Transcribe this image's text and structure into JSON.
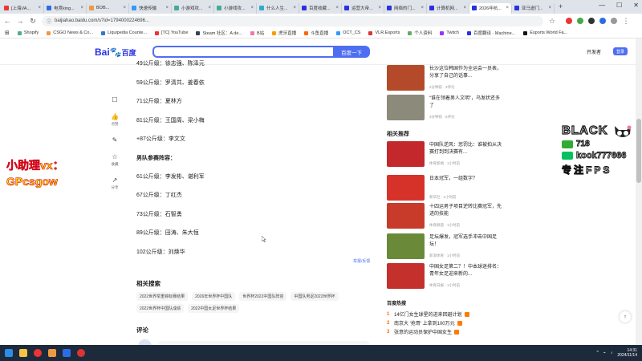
{
  "tabs": [
    {
      "label": "[上海VA...",
      "fav": "#e33"
    },
    {
      "label": "电竞king...",
      "fav": "#2b6de5"
    },
    {
      "label": "BOB...",
      "fav": "#e94"
    },
    {
      "label": "快速传输",
      "fav": "#39f"
    },
    {
      "label": "小游戏攻...",
      "fav": "#4a9"
    },
    {
      "label": "小游戏攻...",
      "fav": "#4a9"
    },
    {
      "label": "什么人生...",
      "fav": "#3ac"
    },
    {
      "label": "百度收藏...",
      "fav": "#2932e1"
    },
    {
      "label": "运营大帝...",
      "fav": "#2932e1"
    },
    {
      "label": "网络的门...",
      "fav": "#2932e1"
    },
    {
      "label": "计算机网...",
      "fav": "#2932e1"
    },
    {
      "label": "2026年杭...",
      "fav": "#2932e1",
      "active": true
    },
    {
      "label": "亚马逊门...",
      "fav": "#2932e1"
    }
  ],
  "address": "baijiahao.baidu.com/s?id=1794000224696...",
  "bookmarks": [
    {
      "label": "Shopify",
      "color": "#5a8"
    },
    {
      "label": "CSGO News & Co...",
      "color": "#e94"
    },
    {
      "label": "Liquipedia Counte...",
      "color": "#37c"
    },
    {
      "label": "[TC] YouTube",
      "color": "#e33"
    },
    {
      "label": "Steam 社区：A de...",
      "color": "#345"
    },
    {
      "label": "B站",
      "color": "#e7a"
    },
    {
      "label": "虎牙直播",
      "color": "#f90"
    },
    {
      "label": "斗鱼直播",
      "color": "#f60"
    },
    {
      "label": "OCT_CS",
      "color": "#39f"
    },
    {
      "label": "VLR.Esports",
      "color": "#d33"
    },
    {
      "label": "个人资料",
      "color": "#6a6"
    },
    {
      "label": "Twitch",
      "color": "#93f"
    },
    {
      "label": "百度翻译 · Machine...",
      "color": "#2932e1"
    },
    {
      "label": "Esports World Fa...",
      "color": "#111"
    }
  ],
  "header": {
    "logo_text": "Bai",
    "logo_du": "度",
    "logo_suffix": "百度",
    "search_button": "百度一下",
    "link": "开发者",
    "login": "登录"
  },
  "side_actions": [
    {
      "icon": "☐",
      "count": ""
    },
    {
      "icon": "👍",
      "count": "点赞"
    },
    {
      "icon": "✎",
      "count": ""
    },
    {
      "icon": "☆",
      "count": "收藏"
    },
    {
      "icon": "↗",
      "count": "分享"
    }
  ],
  "article_lines": [
    {
      "text": "49公斤级：徐志强、陈泽元",
      "section": false
    },
    {
      "text": "59公斤级：罗清共、姜春依",
      "section": false
    },
    {
      "text": "71公斤级：夏林方",
      "section": false
    },
    {
      "text": "81公斤级：王国周、梁小梅",
      "section": false
    },
    {
      "text": "+87公斤级：李文文",
      "section": false
    },
    {
      "text": "男队参赛阵容：",
      "section": true
    },
    {
      "text": "61公斤级：李发彬、谌利军",
      "section": false
    },
    {
      "text": "67公斤级：丁红杰",
      "section": false
    },
    {
      "text": "73公斤级：石智勇",
      "section": false
    },
    {
      "text": "89公斤级：田涛、朱大恒",
      "section": false
    },
    {
      "text": "102公斤级：刘焕华",
      "section": false
    }
  ],
  "report_link": "举报/反馈",
  "related": {
    "title": "相关搜索",
    "tags": [
      "2022世界举重锦标赛结果",
      "2026年世界杯中国队",
      "世界杯2022中国队阵容",
      "中国队男足2022世界杯",
      "2022世界杯中国队成绩",
      "2022中国女足世界杯结果"
    ]
  },
  "comments_title": "评论",
  "right_items_top": [
    {
      "title": "长沙这位韩国作为全运会一员表，分享了自己的话事...",
      "meta": "2分钟前 · 3评论",
      "thumb": "#b54a2a"
    },
    {
      "title": "“谁在领着男人文明”，乌发状还多了",
      "meta": "3分钟前 · 6评论",
      "thumb": "#8c8a7a"
    }
  ],
  "hot_title": "相关推荐",
  "right_items": [
    {
      "title": "中国队逆风：惩罚比：谁被拍从决赛打到到决赛有...",
      "meta": "体育新闻 · 1小时前",
      "thumb": "#c2282c"
    },
    {
      "title": "日本冠军，一组数字？",
      "meta": "新华社 · 1小时前",
      "thumb": "#d7322a"
    },
    {
      "title": "十四运男子项目逆转比赛冠军，先进的技能",
      "meta": "体育频道 · 1小时前",
      "thumb": "#c83a2a"
    },
    {
      "title": "足坛爆发，冠军选手冲击中国足坛！",
      "meta": "新浪体育 · 1小时前",
      "thumb": "#6a8a3a"
    },
    {
      "title": "中国女足第二？！中本球迷排名：青年女足迎来新的...",
      "meta": "体育日报 · 1小时前",
      "thumb": "#c4302c"
    }
  ],
  "hot_list_title": "百度热搜",
  "hot_list": [
    {
      "n": "1",
      "text": "14亿门女生球星的进来回避计划"
    },
    {
      "n": "2",
      "text": "南京大 '抢哥' 上拿到100万元"
    },
    {
      "n": "3",
      "text": "张意的运动员保护中国女生"
    }
  ],
  "overlay": {
    "left_line1": "小助理vx：",
    "left_line2": "GPcsgow",
    "right_title": "BLACK",
    "right_num": "718",
    "right_id": "kook777666",
    "right_foot": "专注FPS"
  },
  "taskbar": {
    "time": "14:31",
    "date": "2024/11/14"
  }
}
